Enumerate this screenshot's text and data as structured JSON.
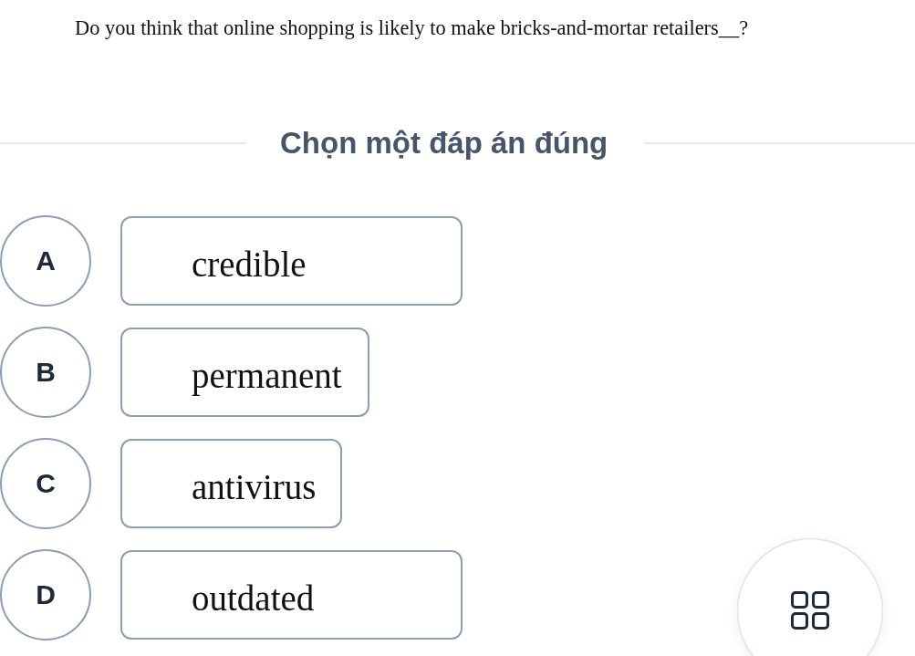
{
  "question": {
    "text": "Do you think that online shopping is likely to make bricks-and-mortar retailers__?"
  },
  "instruction": "Chọn một đáp án đúng",
  "options": [
    {
      "letter": "A",
      "text": "credible",
      "selected": false
    },
    {
      "letter": "B",
      "text": "permanent",
      "selected": false
    },
    {
      "letter": "C",
      "text": "antivirus",
      "selected": false
    },
    {
      "letter": "D",
      "text": "outdated",
      "selected": false
    }
  ]
}
